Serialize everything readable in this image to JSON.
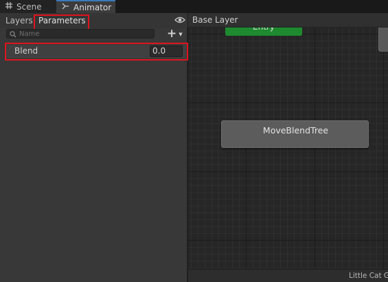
{
  "tabs": [
    {
      "label": "Scene",
      "icon": "grid-icon"
    },
    {
      "label": "Animator",
      "icon": "animator-icon",
      "active": true
    }
  ],
  "left_panel": {
    "subtabs": {
      "layers": "Layers",
      "parameters": "Parameters"
    },
    "search": {
      "placeholder": "Name"
    },
    "parameters": [
      {
        "name": "Blend",
        "value": "0.0"
      }
    ]
  },
  "graph": {
    "breadcrumb": "Base Layer",
    "entry_label": "Entry",
    "node_label": "MoveBlendTree",
    "status_text": "Little Cat Gi"
  },
  "colors": {
    "highlight": "#e0141e",
    "entry_node": "#1e8a2f",
    "active_tab_accent": "#3a79bb"
  }
}
